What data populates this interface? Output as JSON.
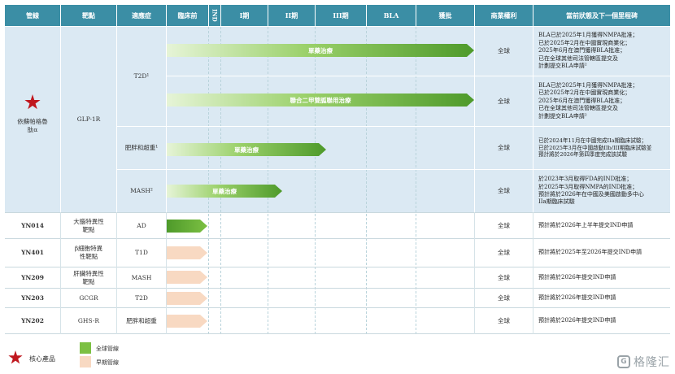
{
  "headers": {
    "pipeline": "管線",
    "target": "靶點",
    "indication": "適應症",
    "preclinical": "臨床前",
    "ind": "IND",
    "phase1": "I期",
    "phase2": "II期",
    "phase3": "III期",
    "bla": "BLA",
    "approved": "獲批",
    "rights": "商業權利",
    "status": "當前狀態及下一個里程碑"
  },
  "core_product": {
    "name": "依蘇帕格魯肽α",
    "target": "GLP-1R",
    "indications": [
      {
        "label": "T2D¹",
        "programs": [
          {
            "arrow_label": "單藥治療",
            "arrow_end": "approved",
            "rights": "全球",
            "status": "BLA已於2025年1月獲得NMPA批准；\n已於2025年2月在中國實現商業化；\n2025年6月在澳門獲得BLA批准；\n已在全球其他司法管轄區提交及\n計劃提交BLA申請²"
          },
          {
            "arrow_label": "聯合二甲雙胍聯用治療",
            "arrow_end": "approved",
            "rights": "全球",
            "status": "BLA已於2025年1月獲得NMPA批准；\n已於2025年2月在中國實現商業化；\n2025年6月在澳門獲得BLA批准；\n已在全球其他司法管轄區提交及\n計劃提交BLA申請²"
          }
        ]
      },
      {
        "label": "肥胖和超重¹",
        "programs": [
          {
            "arrow_label": "單藥治療",
            "arrow_end": "phase2",
            "rights": "全球",
            "status": "已於2024年11月在中國完成IIa期臨床試驗；\n已於2025年3月在中國啟動IIb/III期臨床試驗並\n預計將於2026年第四季度完成該試驗"
          }
        ]
      },
      {
        "label": "MASH²",
        "programs": [
          {
            "arrow_label": "單藥治療",
            "arrow_end": "phase1",
            "rights": "全球",
            "status": "於2023年3月取得FDA的IND批准；\n於2025年3月取得NMPA的IND批准；\n預計將於2026年在中國及美國啟動多中心\nIIa期臨床試驗"
          }
        ]
      }
    ]
  },
  "other_products": [
    {
      "name": "YN014",
      "target": "大腦特異性\n靶點",
      "indication": "AD",
      "stage": "global",
      "rights": "全球",
      "status": "預計將於2026年上半年提交IND申請"
    },
    {
      "name": "YN401",
      "target": "β細胞特異\n性靶點",
      "indication": "T1D",
      "stage": "early",
      "rights": "全球",
      "status": "預計將於2025年至2026年提交IND申請"
    },
    {
      "name": "YN209",
      "target": "肝臟特異性\n靶點",
      "indication": "MASH",
      "stage": "early",
      "rights": "全球",
      "status": "預計將於2026年提交IND申請"
    },
    {
      "name": "YN203",
      "target": "GCGR",
      "indication": "T2D",
      "stage": "early",
      "rights": "全球",
      "status": "預計將於2026年提交IND申請"
    },
    {
      "name": "YN202",
      "target": "GHS-R",
      "indication": "肥胖和超重",
      "stage": "early",
      "rights": "全球",
      "status": "預計將於2026年提交IND申請"
    }
  ],
  "legend": {
    "core": "核心產品",
    "global": "全球管線",
    "early": "早期管線"
  },
  "watermark": "格隆汇",
  "colors": {
    "header_bg": "#3b8ea5",
    "core_bg": "#dbe9f3",
    "arrow_global_dark": "#4e9a2a",
    "arrow_early": "#f8d9c2",
    "star": "#c0171e"
  }
}
